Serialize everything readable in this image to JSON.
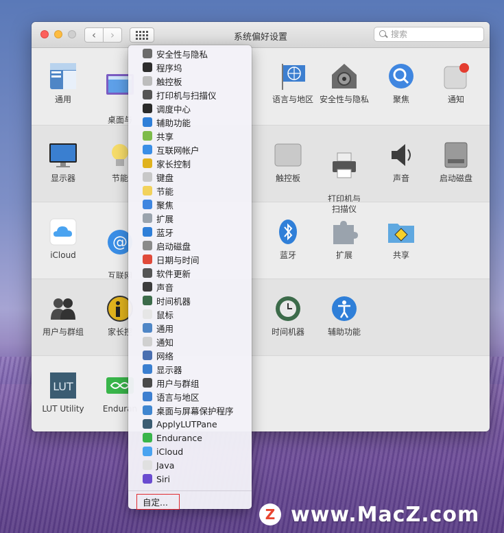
{
  "window": {
    "title": "系统偏好设置",
    "search_placeholder": "搜索",
    "nav": {
      "back": "‹",
      "forward": "›"
    }
  },
  "prefs": {
    "row1": [
      "通用",
      "桌面与\n屏幕保护",
      "语言与地区",
      "安全性与隐私",
      "聚焦",
      "通知"
    ],
    "row2": [
      "显示器",
      "节能",
      "触控板",
      "打印机与\n扫描仪",
      "声音",
      "启动磁盘"
    ],
    "row3": [
      "iCloud",
      "互联网\n帐户",
      "蓝牙",
      "扩展",
      "共享"
    ],
    "row4": [
      "用户与群组",
      "家长控",
      "时间机器",
      "辅助功能"
    ],
    "row5": [
      "LUT Utility",
      "Enduran"
    ]
  },
  "menu": {
    "items": [
      {
        "label": "安全性与隐私",
        "icon": "lock-house-icon",
        "color": "#6b6b6b"
      },
      {
        "label": "程序坞",
        "icon": "dock-icon",
        "color": "#2d2d2d"
      },
      {
        "label": "触控板",
        "icon": "trackpad-icon",
        "color": "#bdbdbd"
      },
      {
        "label": "打印机与扫描仪",
        "icon": "printer-icon",
        "color": "#555555"
      },
      {
        "label": "调度中心",
        "icon": "mission-control-icon",
        "color": "#2a2a2a"
      },
      {
        "label": "辅助功能",
        "icon": "accessibility-icon",
        "color": "#2f7fd8"
      },
      {
        "label": "共享",
        "icon": "sharing-icon",
        "color": "#7dbb4a"
      },
      {
        "label": "互联网帐户",
        "icon": "at-icon",
        "color": "#3a8ee6"
      },
      {
        "label": "家长控制",
        "icon": "parental-controls-icon",
        "color": "#e0b21d"
      },
      {
        "label": "键盘",
        "icon": "keyboard-icon",
        "color": "#c8c8c8"
      },
      {
        "label": "节能",
        "icon": "bulb-icon",
        "color": "#f2d25c"
      },
      {
        "label": "聚焦",
        "icon": "spotlight-icon",
        "color": "#3f86e0"
      },
      {
        "label": "扩展",
        "icon": "puzzle-icon",
        "color": "#9aa3ad"
      },
      {
        "label": "蓝牙",
        "icon": "bluetooth-icon",
        "color": "#2f7fd8"
      },
      {
        "label": "启动磁盘",
        "icon": "disk-icon",
        "color": "#8a8a8a"
      },
      {
        "label": "日期与时间",
        "icon": "calendar-icon",
        "color": "#e04a3a"
      },
      {
        "label": "软件更新",
        "icon": "gear-icon",
        "color": "#555555"
      },
      {
        "label": "声音",
        "icon": "speaker-icon",
        "color": "#3c3c3c"
      },
      {
        "label": "时间机器",
        "icon": "time-machine-icon",
        "color": "#3c6b4a"
      },
      {
        "label": "鼠标",
        "icon": "mouse-icon",
        "color": "#e6e6e6"
      },
      {
        "label": "通用",
        "icon": "general-icon",
        "color": "#4f86c6"
      },
      {
        "label": "通知",
        "icon": "notification-icon",
        "color": "#d0d0d0"
      },
      {
        "label": "网络",
        "icon": "globe-icon",
        "color": "#4a6fb0"
      },
      {
        "label": "显示器",
        "icon": "display-icon",
        "color": "#3a7fd0"
      },
      {
        "label": "用户与群组",
        "icon": "users-icon",
        "color": "#4a4a4a"
      },
      {
        "label": "语言与地区",
        "icon": "flag-icon",
        "color": "#3d7fd0"
      },
      {
        "label": "桌面与屏幕保护程序",
        "icon": "desktop-icon",
        "color": "#3f86d0"
      },
      {
        "label": "ApplyLUTPane",
        "icon": "lut-icon",
        "color": "#3b5c72"
      },
      {
        "label": "Endurance",
        "icon": "infinity-icon",
        "color": "#39b54a"
      },
      {
        "label": "iCloud",
        "icon": "cloud-icon",
        "color": "#4aa3f0"
      },
      {
        "label": "Java",
        "icon": "java-icon",
        "color": "#e0e0e0"
      },
      {
        "label": "Siri",
        "icon": "siri-icon",
        "color": "#6a4bd0"
      }
    ],
    "customize": "自定..."
  },
  "watermark": {
    "logo": "Z",
    "text": "www.MacZ.com"
  }
}
